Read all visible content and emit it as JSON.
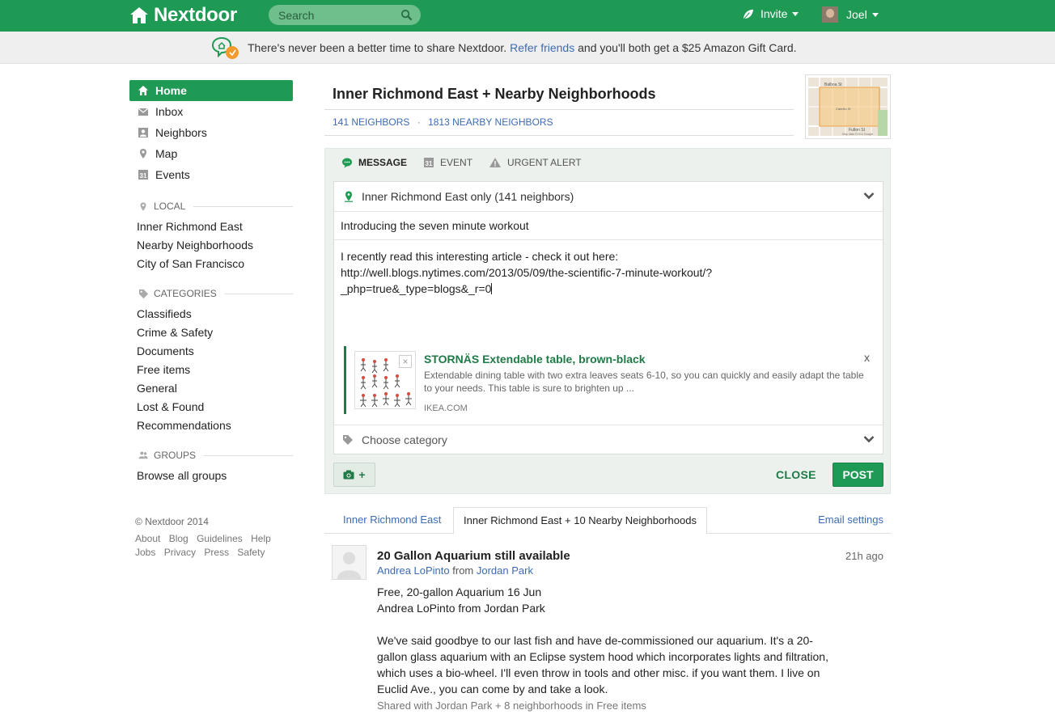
{
  "header": {
    "logo": "Nextdoor",
    "search_placeholder": "Search",
    "invite": "Invite",
    "user": "Joel"
  },
  "promo": {
    "before": "There's never been a better time to share Nextdoor.",
    "link": "Refer friends",
    "after": "and you'll both get a $25 Amazon Gift Card."
  },
  "sidebar": {
    "nav": [
      "Home",
      "Inbox",
      "Neighbors",
      "Map",
      "Events"
    ],
    "events_icon_num": "31",
    "local_heading": "LOCAL",
    "local": [
      "Inner Richmond East",
      "Nearby Neighborhoods",
      "City of San Francisco"
    ],
    "categories_heading": "CATEGORIES",
    "categories": [
      "Classifieds",
      "Crime & Safety",
      "Documents",
      "Free items",
      "General",
      "Lost & Found",
      "Recommendations"
    ],
    "groups_heading": "GROUPS",
    "groups": [
      "Browse all groups"
    ],
    "copyright": "© Nextdoor 2014",
    "footer1": [
      "About",
      "Blog",
      "Guidelines",
      "Help"
    ],
    "footer2": [
      "Jobs",
      "Privacy",
      "Press",
      "Safety"
    ]
  },
  "main": {
    "title": "Inner Richmond East + Nearby Neighborhoods",
    "neighbors": "141 NEIGHBORS",
    "sep": "·",
    "nearby": "1813 NEARBY NEIGHBORS",
    "map": {
      "street1": "Balboa St",
      "street2": "Fulton St",
      "street3": "Cabrillo St",
      "attribution": "Map data ©2014 Google"
    }
  },
  "composer": {
    "tabs": [
      "MESSAGE",
      "EVENT",
      "URGENT ALERT"
    ],
    "event_icon_num": "31",
    "audience": "Inner Richmond East only (141 neighbors)",
    "subject": "Introducing the seven minute workout",
    "body": "I recently read this interesting article - check it out here:\nhttp://well.blogs.nytimes.com/2013/05/09/the-scientific-7-minute-workout/?\n_php=true&_type=blogs&_r=0",
    "link_title": "STORNÄS Extendable table, brown-black",
    "link_desc": "Extendable dining table with two extra leaves seats 6-10, so you can quickly and easily adapt the table to your needs. This table is sure to brighten up ...",
    "link_source": "IKEA.COM",
    "link_close": "x",
    "thumb_close": "×",
    "category_placeholder": "Choose category",
    "photo_plus": "+",
    "close": "CLOSE",
    "post": "POST"
  },
  "feed_tabs": {
    "tab1": "Inner Richmond East",
    "tab2": "Inner Richmond East + 10 Nearby Neighborhoods",
    "email": "Email settings"
  },
  "post": {
    "title": "20 Gallon Aquarium still available",
    "author": "Andrea LoPinto",
    "from": "from",
    "place": "Jordan Park",
    "time": "21h ago",
    "line1": "Free, 20-gallon Aquarium 16 Jun",
    "line2": "Andrea LoPinto from Jordan Park",
    "para": "We've said goodbye to our last fish and have de-commissioned our aquarium. It's a 20-gallon glass aquarium with an Eclipse system hood which incorporates lights and filtration, which uses a bio-wheel. I'll even throw in tools and other misc. if you want them. I live on Euclid Ave., you can come by and take a look.",
    "shared": "Shared with Jordan Park + 8 neighborhoods in Free items"
  },
  "colors": {
    "brand_green": "#1f9a54",
    "link_blue": "#3d6bb3",
    "composer_bg": "#ecf1ed"
  }
}
